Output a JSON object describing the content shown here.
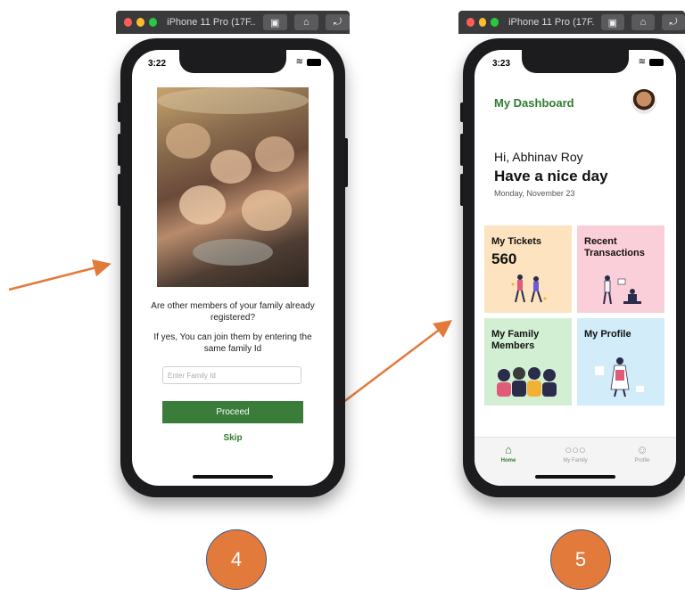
{
  "simulator": {
    "left": {
      "title": "iPhone 11 Pro (17F..."
    },
    "right": {
      "title": "iPhone 11 Pro (17F..."
    }
  },
  "screen4": {
    "time": "3:22",
    "question": "Are other members of your family already registered?",
    "info": "If yes, You can join them by entering the same family Id",
    "family_id_placeholder": "Enter Family Id",
    "proceed_label": "Proceed",
    "skip_label": "Skip"
  },
  "screen5": {
    "time": "3:23",
    "title": "My Dashboard",
    "greeting": "Hi, Abhinav Roy",
    "subtitle": "Have a nice day",
    "date": "Monday, November 23",
    "cards": [
      {
        "title": "My Tickets",
        "value": "560",
        "color": "#fde3bf"
      },
      {
        "title": "Recent Transactions",
        "color": "#fbcfd9"
      },
      {
        "title": "My Family Members",
        "color": "#d2efd3"
      },
      {
        "title": "My Profile",
        "color": "#d3ecf9"
      }
    ],
    "tabs": [
      {
        "label": "Home",
        "icon": "home-icon",
        "active": true
      },
      {
        "label": "My Family",
        "icon": "family-icon",
        "active": false
      },
      {
        "label": "Profile",
        "icon": "profile-icon",
        "active": false
      }
    ]
  },
  "badges": {
    "left": "4",
    "right": "5"
  },
  "colors": {
    "accent_green": "#2f7d32",
    "arrow": "#e27a3c",
    "badge": "#e27a3c"
  }
}
